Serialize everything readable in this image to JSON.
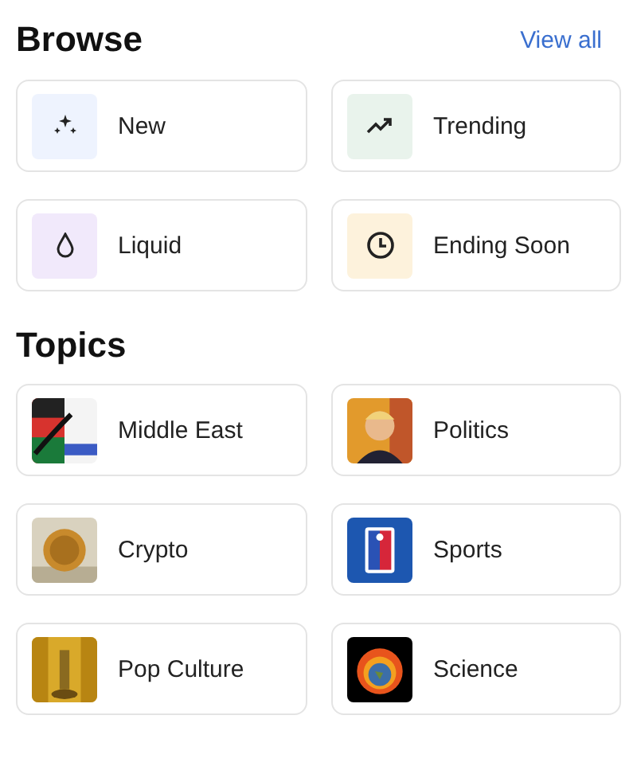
{
  "browse": {
    "title": "Browse",
    "link": "View all",
    "items": [
      {
        "label": "New"
      },
      {
        "label": "Trending"
      },
      {
        "label": "Liquid"
      },
      {
        "label": "Ending Soon"
      }
    ]
  },
  "topics": {
    "title": "Topics",
    "items": [
      {
        "label": "Middle East",
        "kind": "picture"
      },
      {
        "label": "Politics",
        "kind": "picture"
      },
      {
        "label": "Crypto",
        "kind": "picture"
      },
      {
        "label": "Sports",
        "kind": "picture"
      },
      {
        "label": "Pop Culture",
        "kind": "picture"
      },
      {
        "label": "Science",
        "kind": "picture"
      }
    ]
  }
}
